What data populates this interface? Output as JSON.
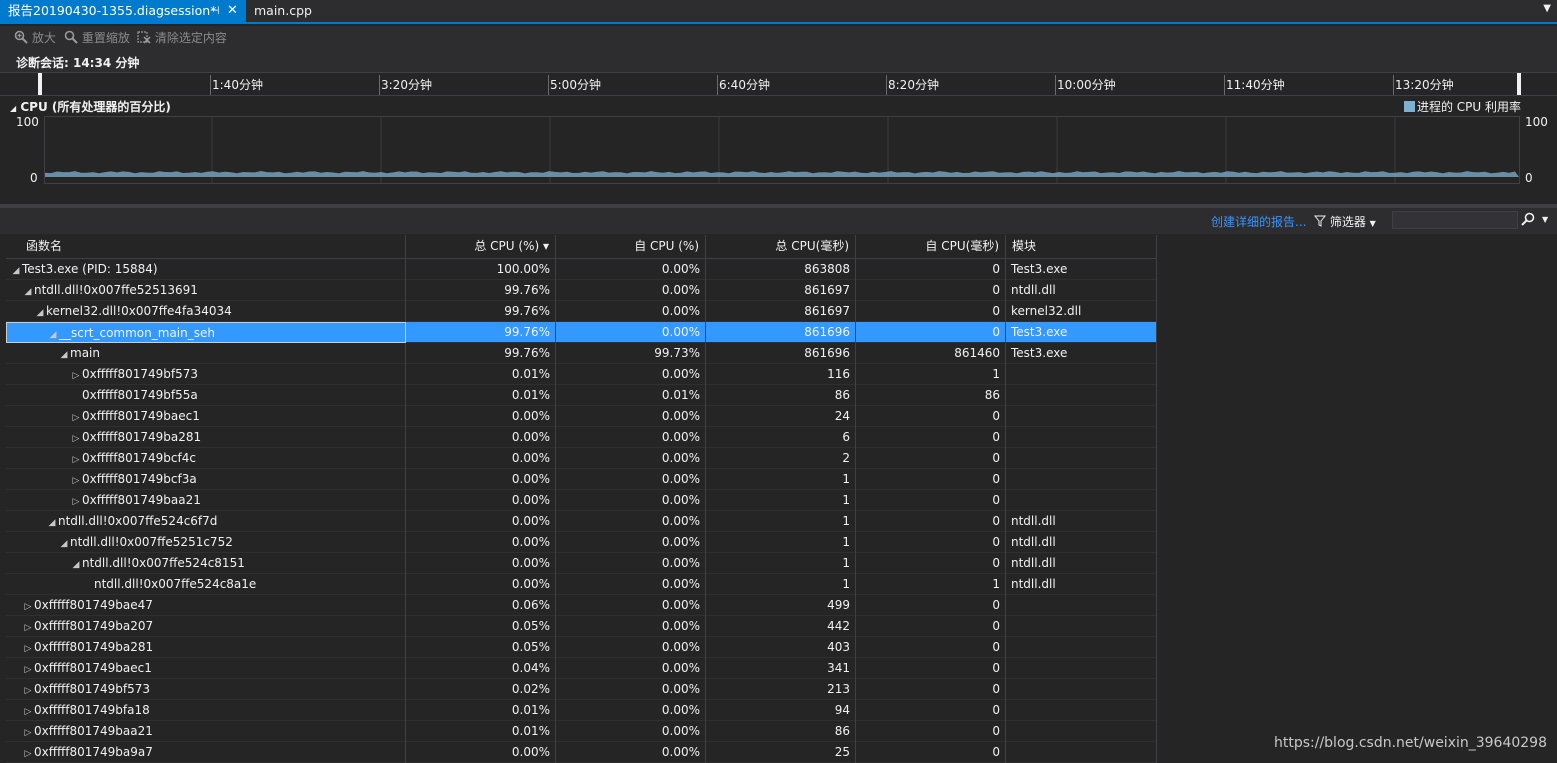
{
  "tabs": {
    "active_label": "报告20190430-1355.diagsession*",
    "pin_glyph": "⊣",
    "close_glyph": "✕",
    "inactive_label": "main.cpp",
    "dropdown_glyph": "▼"
  },
  "toolbar": {
    "zoom_in": "放大",
    "reset_zoom": "重置缩放",
    "clear_selection": "清除选定内容"
  },
  "session": {
    "label": "诊断会话: 14:34 分钟"
  },
  "ruler": {
    "ticks": [
      "1:40分钟",
      "3:20分钟",
      "5:00分钟",
      "6:40分钟",
      "8:20分钟",
      "10:00分钟",
      "11:40分钟",
      "13:20分钟"
    ]
  },
  "cpu": {
    "title": "CPU (所有处理器的百分比)",
    "legend": "进程的 CPU 利用率",
    "y_max": "100",
    "y_min": "0",
    "level_percent": 8,
    "color": "#7fb0cf"
  },
  "report_bar": {
    "create_report": "创建详细的报告...",
    "filter_label": "筛选器",
    "search_icon": "🔍"
  },
  "table": {
    "headers": [
      "函数名",
      "总 CPU (%) ▾",
      "自 CPU (%)",
      "总 CPU(毫秒)",
      "自 CPU(毫秒)",
      "模块"
    ],
    "rows": [
      {
        "depth": 0,
        "exp": "◢",
        "name": "Test3.exe (PID: 15884)",
        "tot": "100.00%",
        "self": "0.00%",
        "totms": "863808",
        "selfms": "0",
        "mod": "Test3.exe"
      },
      {
        "depth": 1,
        "exp": "◢",
        "name": "ntdll.dll!0x007ffe52513691",
        "tot": "99.76%",
        "self": "0.00%",
        "totms": "861697",
        "selfms": "0",
        "mod": "ntdll.dll"
      },
      {
        "depth": 2,
        "exp": "◢",
        "name": "kernel32.dll!0x007ffe4fa34034",
        "tot": "99.76%",
        "self": "0.00%",
        "totms": "861697",
        "selfms": "0",
        "mod": "kernel32.dll"
      },
      {
        "depth": 3,
        "exp": "◢",
        "name": "__scrt_common_main_seh",
        "tot": "99.76%",
        "self": "0.00%",
        "totms": "861696",
        "selfms": "0",
        "mod": "Test3.exe",
        "sel": true
      },
      {
        "depth": 4,
        "exp": "◢",
        "name": "main",
        "tot": "99.76%",
        "self": "99.73%",
        "totms": "861696",
        "selfms": "861460",
        "mod": "Test3.exe"
      },
      {
        "depth": 5,
        "exp": "▷",
        "name": "0xfffff801749bf573",
        "tot": "0.01%",
        "self": "0.00%",
        "totms": "116",
        "selfms": "1",
        "mod": ""
      },
      {
        "depth": 5,
        "exp": "",
        "name": "0xfffff801749bf55a",
        "tot": "0.01%",
        "self": "0.01%",
        "totms": "86",
        "selfms": "86",
        "mod": ""
      },
      {
        "depth": 5,
        "exp": "▷",
        "name": "0xfffff801749baec1",
        "tot": "0.00%",
        "self": "0.00%",
        "totms": "24",
        "selfms": "0",
        "mod": ""
      },
      {
        "depth": 5,
        "exp": "▷",
        "name": "0xfffff801749ba281",
        "tot": "0.00%",
        "self": "0.00%",
        "totms": "6",
        "selfms": "0",
        "mod": ""
      },
      {
        "depth": 5,
        "exp": "▷",
        "name": "0xfffff801749bcf4c",
        "tot": "0.00%",
        "self": "0.00%",
        "totms": "2",
        "selfms": "0",
        "mod": ""
      },
      {
        "depth": 5,
        "exp": "▷",
        "name": "0xfffff801749bcf3a",
        "tot": "0.00%",
        "self": "0.00%",
        "totms": "1",
        "selfms": "0",
        "mod": ""
      },
      {
        "depth": 5,
        "exp": "▷",
        "name": "0xfffff801749baa21",
        "tot": "0.00%",
        "self": "0.00%",
        "totms": "1",
        "selfms": "0",
        "mod": ""
      },
      {
        "depth": 3,
        "exp": "◢",
        "name": "ntdll.dll!0x007ffe524c6f7d",
        "tot": "0.00%",
        "self": "0.00%",
        "totms": "1",
        "selfms": "0",
        "mod": "ntdll.dll"
      },
      {
        "depth": 4,
        "exp": "◢",
        "name": "ntdll.dll!0x007ffe5251c752",
        "tot": "0.00%",
        "self": "0.00%",
        "totms": "1",
        "selfms": "0",
        "mod": "ntdll.dll"
      },
      {
        "depth": 5,
        "exp": "◢",
        "name": "ntdll.dll!0x007ffe524c8151",
        "tot": "0.00%",
        "self": "0.00%",
        "totms": "1",
        "selfms": "0",
        "mod": "ntdll.dll"
      },
      {
        "depth": 6,
        "exp": "",
        "name": "ntdll.dll!0x007ffe524c8a1e",
        "tot": "0.00%",
        "self": "0.00%",
        "totms": "1",
        "selfms": "1",
        "mod": "ntdll.dll"
      },
      {
        "depth": 1,
        "exp": "▷",
        "name": "0xfffff801749bae47",
        "tot": "0.06%",
        "self": "0.00%",
        "totms": "499",
        "selfms": "0",
        "mod": ""
      },
      {
        "depth": 1,
        "exp": "▷",
        "name": "0xfffff801749ba207",
        "tot": "0.05%",
        "self": "0.00%",
        "totms": "442",
        "selfms": "0",
        "mod": ""
      },
      {
        "depth": 1,
        "exp": "▷",
        "name": "0xfffff801749ba281",
        "tot": "0.05%",
        "self": "0.00%",
        "totms": "403",
        "selfms": "0",
        "mod": ""
      },
      {
        "depth": 1,
        "exp": "▷",
        "name": "0xfffff801749baec1",
        "tot": "0.04%",
        "self": "0.00%",
        "totms": "341",
        "selfms": "0",
        "mod": ""
      },
      {
        "depth": 1,
        "exp": "▷",
        "name": "0xfffff801749bf573",
        "tot": "0.02%",
        "self": "0.00%",
        "totms": "213",
        "selfms": "0",
        "mod": ""
      },
      {
        "depth": 1,
        "exp": "▷",
        "name": "0xfffff801749bfa18",
        "tot": "0.01%",
        "self": "0.00%",
        "totms": "94",
        "selfms": "0",
        "mod": ""
      },
      {
        "depth": 1,
        "exp": "▷",
        "name": "0xfffff801749baa21",
        "tot": "0.01%",
        "self": "0.00%",
        "totms": "86",
        "selfms": "0",
        "mod": ""
      },
      {
        "depth": 1,
        "exp": "▷",
        "name": "0xfffff801749ba9a7",
        "tot": "0.00%",
        "self": "0.00%",
        "totms": "25",
        "selfms": "0",
        "mod": ""
      }
    ]
  },
  "watermark": "https://blog.csdn.net/weixin_39640298"
}
